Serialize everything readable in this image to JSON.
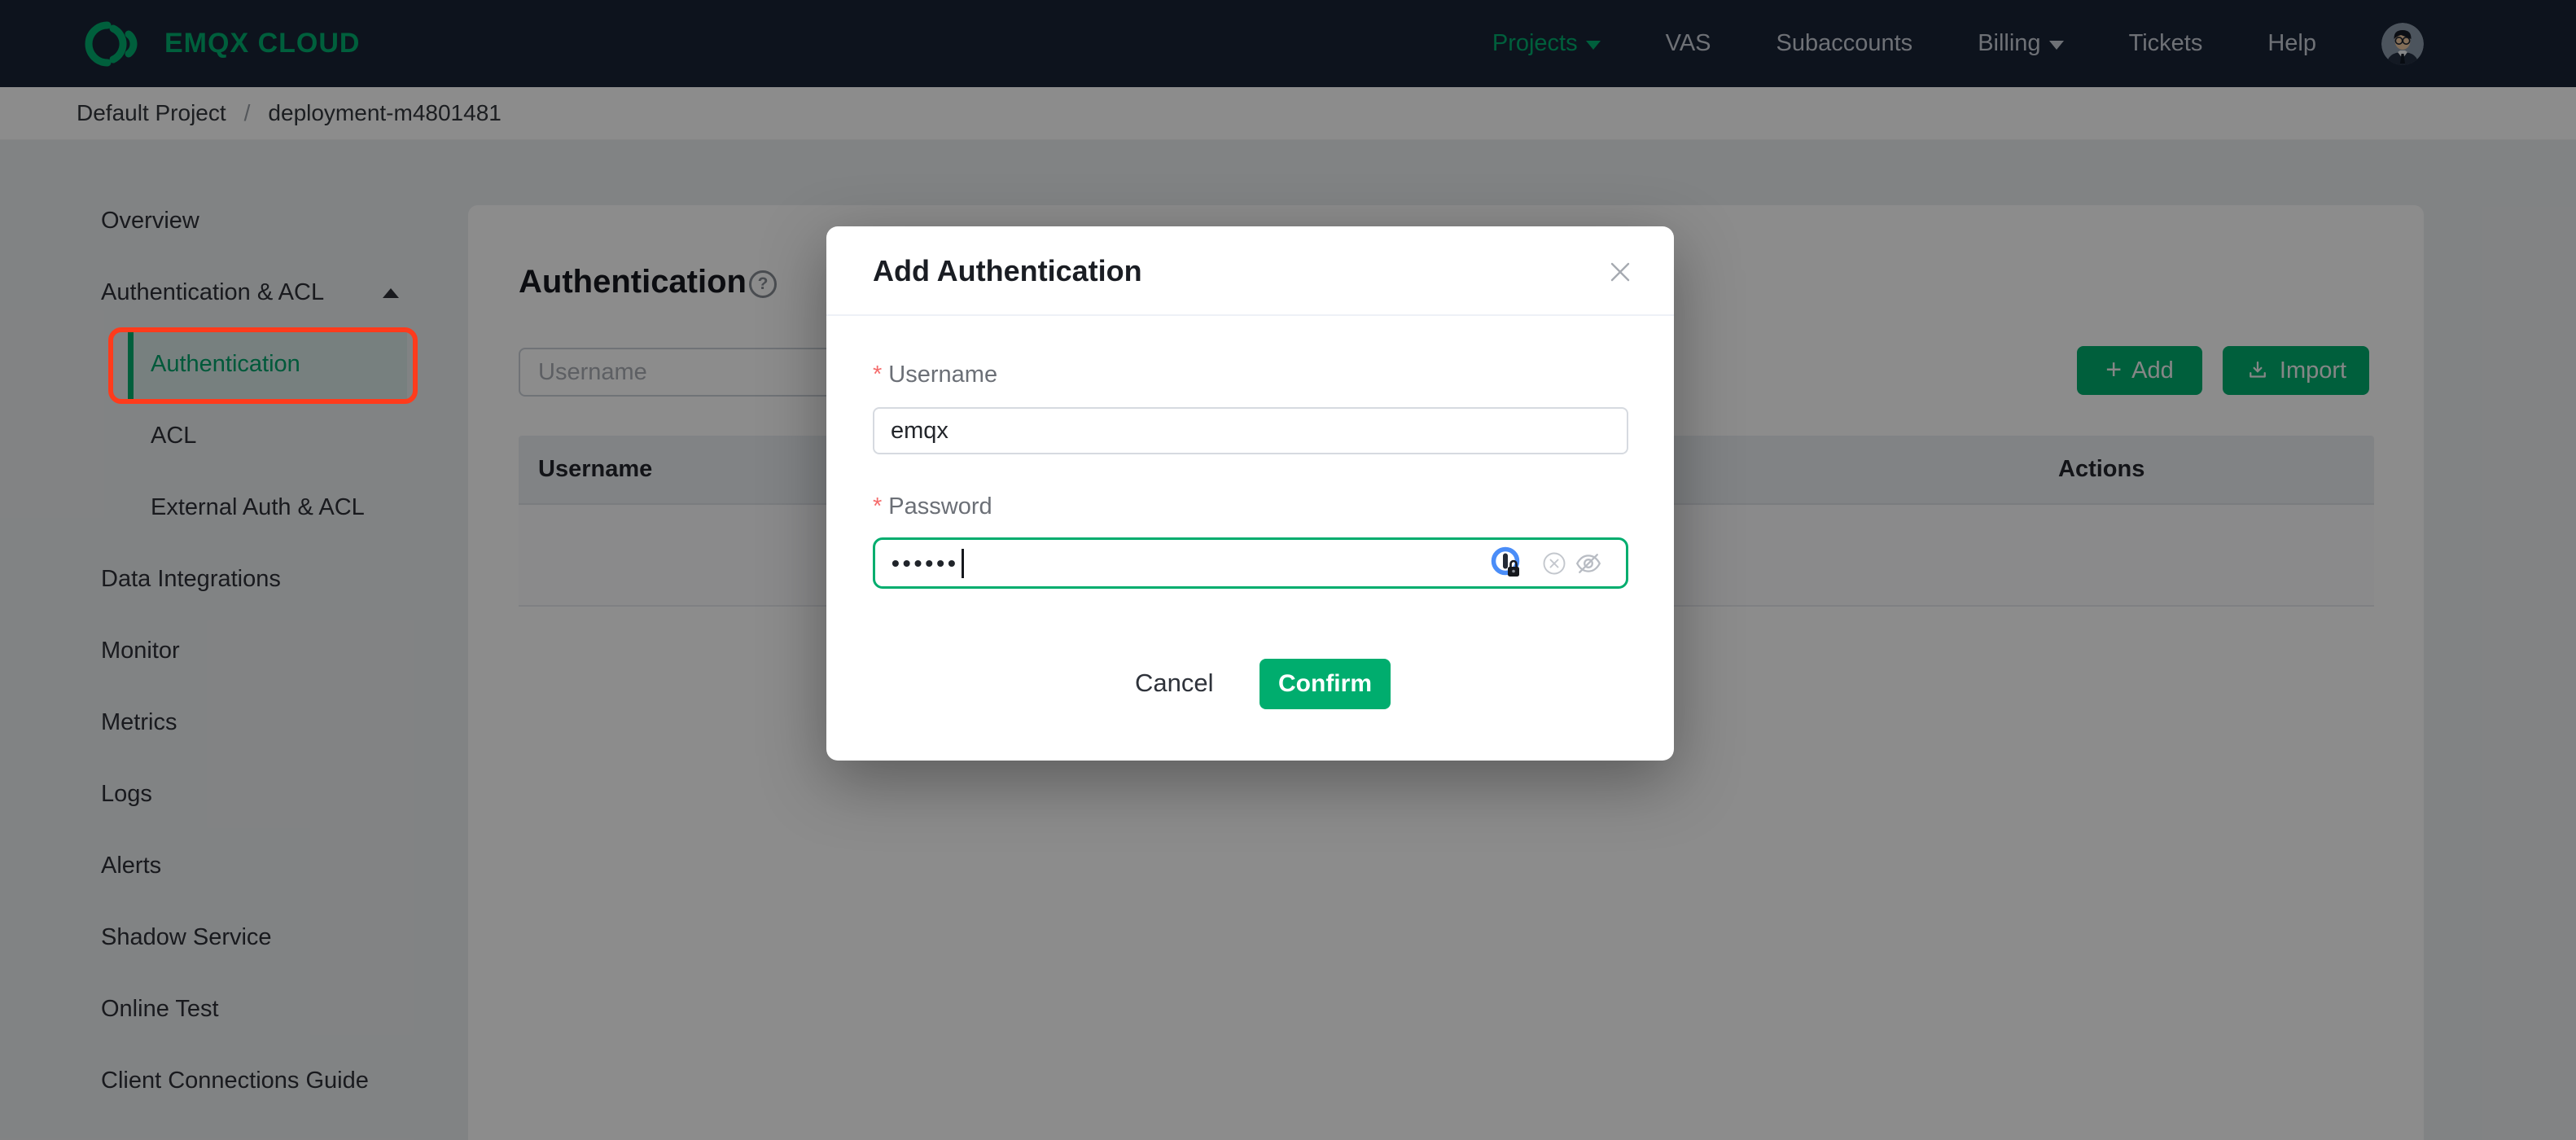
{
  "colors": {
    "brand_green": "#00AD6E",
    "nav_bg": "#192335",
    "annotation_red": "#FF3B1C",
    "required_red": "#F56C6C"
  },
  "topnav": {
    "brand": "EMQX CLOUD",
    "items": [
      {
        "label": "Projects"
      },
      {
        "label": "VAS"
      },
      {
        "label": "Subaccounts"
      },
      {
        "label": "Billing"
      },
      {
        "label": "Tickets"
      },
      {
        "label": "Help"
      }
    ]
  },
  "breadcrumb": {
    "project": "Default Project",
    "separator": "/",
    "current": "deployment-m4801481"
  },
  "sidebar": {
    "items": [
      {
        "label": "Overview"
      },
      {
        "label": "Authentication & ACL"
      },
      {
        "label": "Authentication"
      },
      {
        "label": "ACL"
      },
      {
        "label": "External Auth & ACL"
      },
      {
        "label": "Data Integrations"
      },
      {
        "label": "Monitor"
      },
      {
        "label": "Metrics"
      },
      {
        "label": "Logs"
      },
      {
        "label": "Alerts"
      },
      {
        "label": "Shadow Service"
      },
      {
        "label": "Online Test"
      },
      {
        "label": "Client Connections Guide"
      }
    ]
  },
  "main": {
    "title": "Authentication",
    "help_glyph": "?",
    "search_placeholder": "Username",
    "add_label": "Add",
    "import_label": "Import",
    "table": {
      "headers": [
        {
          "label": "Username"
        },
        {
          "label": "Actions"
        }
      ]
    }
  },
  "modal": {
    "title": "Add Authentication",
    "username": {
      "required_mark": "*",
      "label": "Username",
      "value": "emqx"
    },
    "password": {
      "required_mark": "*",
      "label": "Password",
      "masked_value": "••••••"
    },
    "cancel_label": "Cancel",
    "confirm_label": "Confirm"
  }
}
